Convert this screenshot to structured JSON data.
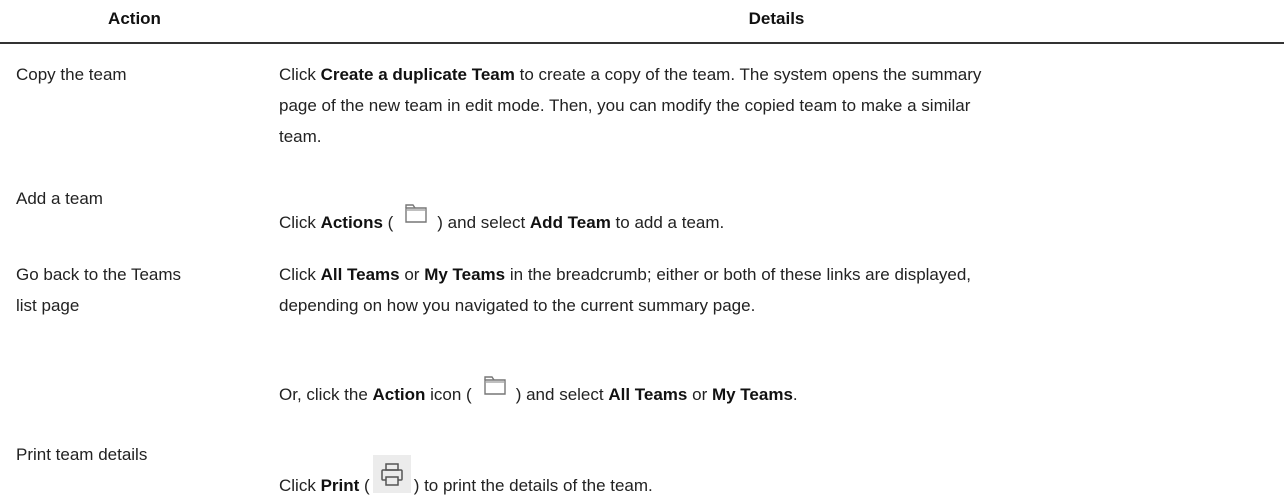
{
  "table": {
    "headers": {
      "action": "Action",
      "details": "Details"
    },
    "rows": [
      {
        "action": "Copy the team",
        "details": {
          "pre": "Click ",
          "bold": "Create a duplicate Team",
          "line1_rest": " to create a copy of the team. The system opens the summary",
          "line2": "page of the new team in edit mode. Then, you can modify the copied team to make a similar",
          "line3": "team."
        }
      },
      {
        "action": "Add a team",
        "details": {
          "pre": "Click ",
          "bold1": "Actions",
          "paren_open": " (",
          "icon": "folder-icon",
          "mid": ") and select ",
          "bold2": "Add Team",
          "post": " to add a team."
        }
      },
      {
        "action_line1": "Go back to the Teams",
        "action_line2": "list page",
        "details": {
          "pre": "Click ",
          "bold1": "All Teams",
          "or": " or ",
          "bold2": "My Teams",
          "line1_rest": " in the breadcrumb; either or both of these links are displayed,",
          "line2": "depending on how you navigated to the current summary page.",
          "alt_pre": "Or, click the ",
          "alt_bold1": "Action",
          "alt_mid": " icon (",
          "alt_icon": "folder-icon",
          "alt_after": ") and select ",
          "alt_bold2": "All Teams",
          "alt_or": " or ",
          "alt_bold3": "My Teams",
          "alt_end": "."
        }
      },
      {
        "action": "Print team details",
        "details": {
          "pre": "Click ",
          "bold": "Print",
          "paren_open": " (",
          "icon": "printer-icon",
          "post": ") to print the details of the team."
        }
      }
    ]
  }
}
